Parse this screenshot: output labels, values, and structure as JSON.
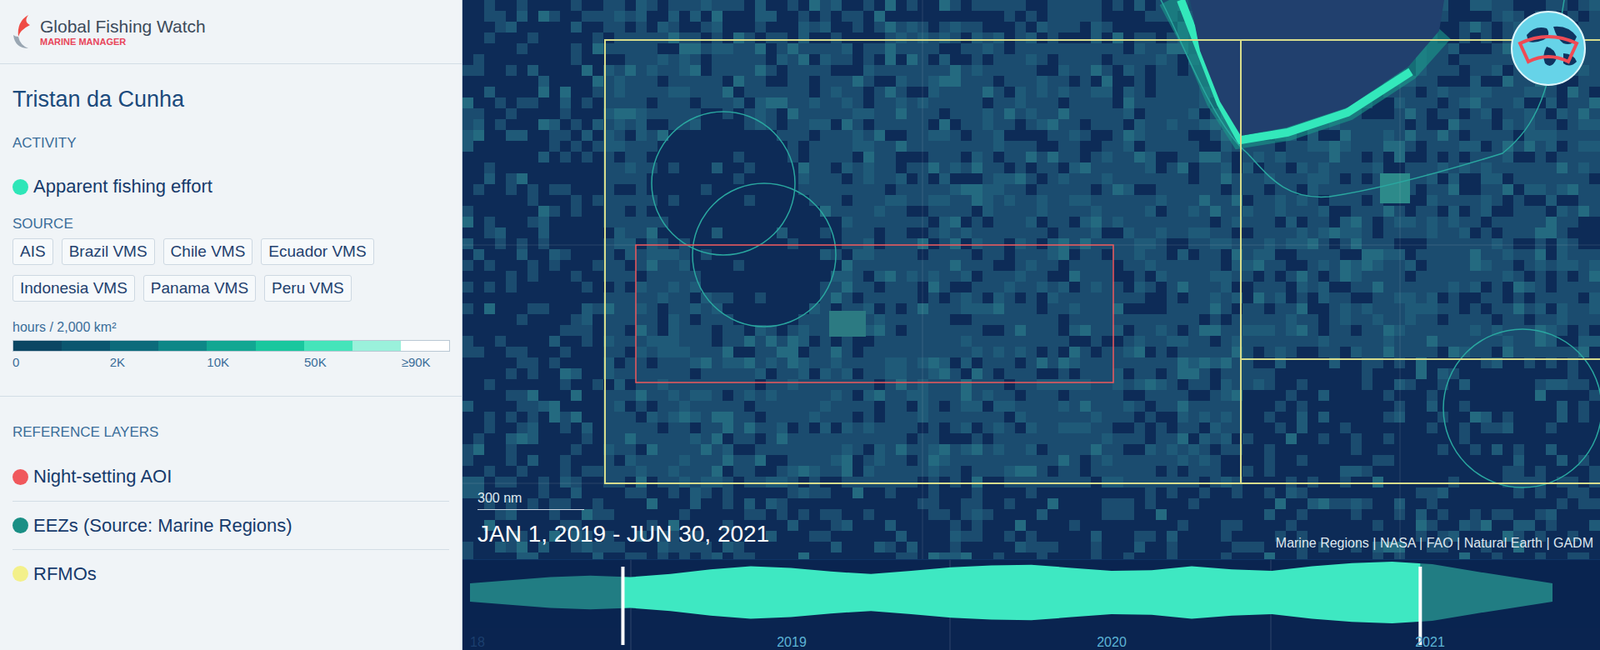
{
  "app": {
    "brand": "Global Fishing Watch",
    "product": "MARINE MANAGER"
  },
  "sidebar": {
    "title": "Tristan da Cunha",
    "activity": {
      "heading": "ACTIVITY",
      "layers": [
        {
          "label": "Apparent fishing effort",
          "color": "#2ee6b8"
        }
      ]
    },
    "source": {
      "heading": "SOURCE",
      "chips": [
        "AIS",
        "Brazil VMS",
        "Chile VMS",
        "Ecuador VMS",
        "Indonesia VMS",
        "Panama VMS",
        "Peru VMS"
      ]
    },
    "legend": {
      "unit": "hours / 2,000 km²",
      "steps": [
        "#0b4663",
        "#0b566f",
        "#0c6b7b",
        "#0e8787",
        "#12a792",
        "#19c79e",
        "#45e4ba",
        "#9af1db",
        "#ffffff"
      ],
      "ticks": [
        "0",
        "2K",
        "10K",
        "50K",
        "≥90K"
      ]
    },
    "reference_layers": {
      "heading": "REFERENCE LAYERS",
      "items": [
        {
          "label": "Night-setting AOI",
          "color": "#f0585c"
        },
        {
          "label": "EEZs (Source: Marine Regions)",
          "color": "#1a8f85"
        },
        {
          "label": "RFMOs",
          "color": "#f3f08a"
        }
      ]
    }
  },
  "map": {
    "scale": "300 nm",
    "date_range": "JAN 1, 2019 - JUN 30, 2021",
    "attribution": "Marine Regions | NASA | FAO | Natural Earth | GADM"
  },
  "timeline": {
    "labels": [
      "18",
      "2019",
      "2020",
      "2021"
    ],
    "activity": [
      0.3,
      0.4,
      0.5,
      0.55,
      0.5,
      0.6,
      0.75,
      0.85,
      0.8,
      0.68,
      0.6,
      0.7,
      0.82,
      0.88,
      0.9,
      0.8,
      0.7,
      0.72,
      0.85,
      0.75,
      0.7,
      0.85,
      0.95,
      1.0,
      0.92,
      0.7,
      0.5,
      0.3
    ],
    "selection": {
      "start": 0.141,
      "end": 0.842
    }
  }
}
